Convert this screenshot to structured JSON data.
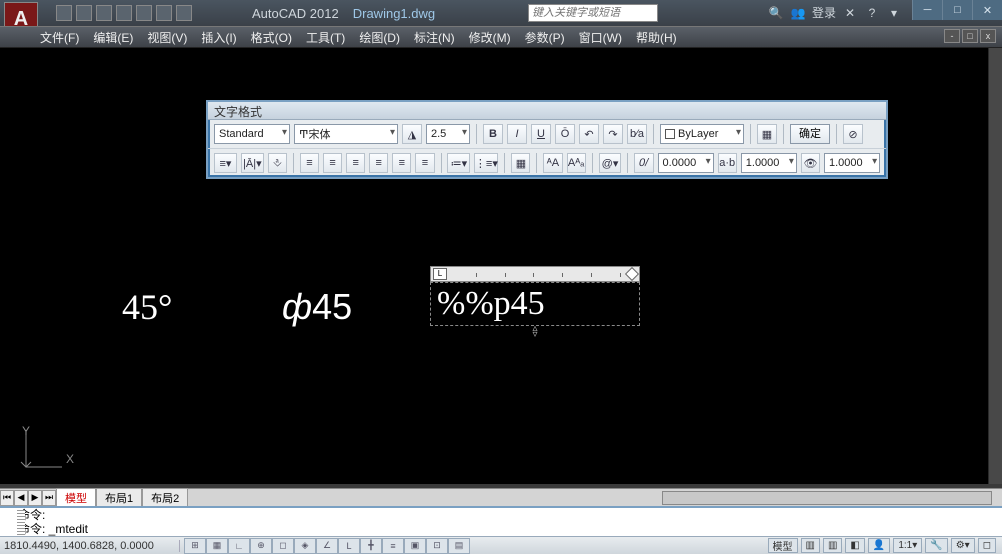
{
  "title": {
    "app": "AutoCAD 2012",
    "doc": "Drawing1.dwg"
  },
  "search": {
    "placeholder": "键入关键字或短语"
  },
  "login": "登录",
  "menu": [
    "文件(F)",
    "编辑(E)",
    "视图(V)",
    "插入(I)",
    "格式(O)",
    "工具(T)",
    "绘图(D)",
    "标注(N)",
    "修改(M)",
    "参数(P)",
    "窗口(W)",
    "帮助(H)"
  ],
  "fmt": {
    "title": "文字格式",
    "style": "Standard",
    "font": "宋体",
    "size": "2.5",
    "bold": "B",
    "italic": "I",
    "under": "U",
    "over": "Ō",
    "undo": "↶",
    "redo": "↷",
    "frac": "b⁄a",
    "layer": "ByLayer",
    "ruler": "▦",
    "ok": "确定",
    "opts": "⊘",
    "row2_btns": [
      "≡▾",
      "|Ā|▾",
      "⎀"
    ],
    "aligns": [
      "≡",
      "≡",
      "≡",
      "≡",
      "≡",
      "≡"
    ],
    "list": [
      "≔▾",
      "⋮≡▾"
    ],
    "misc": [
      "▦",
      "ᴬA",
      "Aᴬₐ"
    ],
    "at": "@▾",
    "slash": "0/",
    "n1": "0.0000",
    "ab": "a·b",
    "n2": "1.0000",
    "eye": "👁",
    "n3": "1.0000"
  },
  "canvas": {
    "t1": "45°",
    "t2_phi": "ф",
    "t2_num": "45",
    "mtext": "%%p45"
  },
  "layouts": {
    "model": "模型",
    "l1": "布局1",
    "l2": "布局2"
  },
  "cmd": {
    "l1": "命令:",
    "l2": "命令: _mtedit"
  },
  "status": {
    "coords": "1810.4490, 1400.6828, 0.0000",
    "right": [
      "模型",
      "▥",
      "▥",
      "◧",
      "👤",
      "1:1▾",
      "🔧",
      "⚙▾",
      "◻"
    ]
  }
}
